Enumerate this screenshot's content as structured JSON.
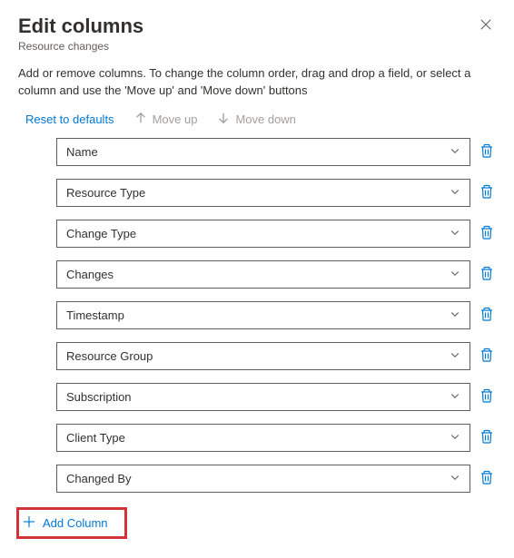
{
  "header": {
    "title": "Edit columns",
    "subtitle": "Resource changes"
  },
  "description": "Add or remove columns. To change the column order, drag and drop a field, or select a column and use the 'Move up' and 'Move down' buttons",
  "toolbar": {
    "reset_label": "Reset to defaults",
    "moveup_label": "Move up",
    "movedown_label": "Move down"
  },
  "columns": [
    {
      "label": "Name"
    },
    {
      "label": "Resource Type"
    },
    {
      "label": "Change Type"
    },
    {
      "label": "Changes"
    },
    {
      "label": "Timestamp"
    },
    {
      "label": "Resource Group"
    },
    {
      "label": "Subscription"
    },
    {
      "label": "Client Type"
    },
    {
      "label": "Changed By"
    }
  ],
  "add_column_label": "Add Column"
}
